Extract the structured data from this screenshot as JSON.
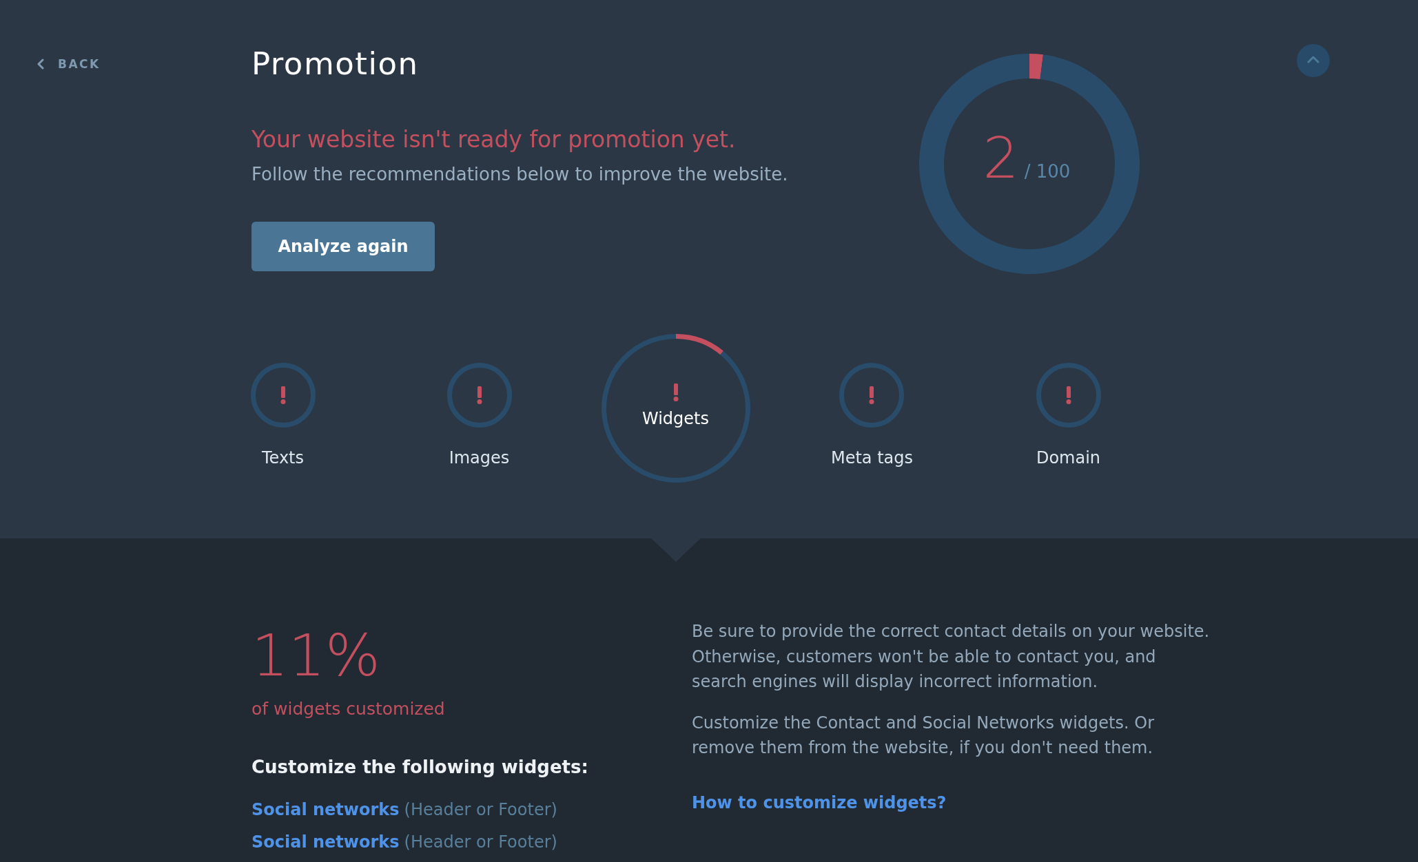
{
  "back": {
    "label": "BACK"
  },
  "title": "Promotion",
  "status": {
    "heading": "Your website isn't ready for promotion yet.",
    "text": "Follow the recommendations below to improve the website."
  },
  "analyze_button": "Analyze again",
  "score": {
    "value": "2",
    "max": "/ 100",
    "chart_data": {
      "type": "donut",
      "values": [
        2,
        98
      ]
    }
  },
  "categories": [
    {
      "label": "Texts",
      "selected": false,
      "warning": true
    },
    {
      "label": "Images",
      "selected": false,
      "warning": true
    },
    {
      "label": "Widgets",
      "selected": true,
      "warning": true,
      "chart_data": {
        "type": "donut",
        "values": [
          11,
          89
        ]
      }
    },
    {
      "label": "Meta tags",
      "selected": false,
      "warning": true
    },
    {
      "label": "Domain",
      "selected": false,
      "warning": true
    }
  ],
  "details": {
    "percent": "11%",
    "percent_caption": "of widgets customized",
    "list_title": "Customize the following widgets:",
    "widgets": [
      {
        "name": "Social networks",
        "location": "(Header or Footer)"
      },
      {
        "name": "Social networks",
        "location": "(Header or Footer)"
      }
    ],
    "paragraphs": [
      "Be sure to provide the correct contact details on your website. Otherwise, customers won't be able to contact you, and search engines will display incorrect information.",
      "Customize the Contact and Social Networks widgets. Or remove them from the website, if you don't need them."
    ],
    "help_link": "How to customize widgets?"
  }
}
